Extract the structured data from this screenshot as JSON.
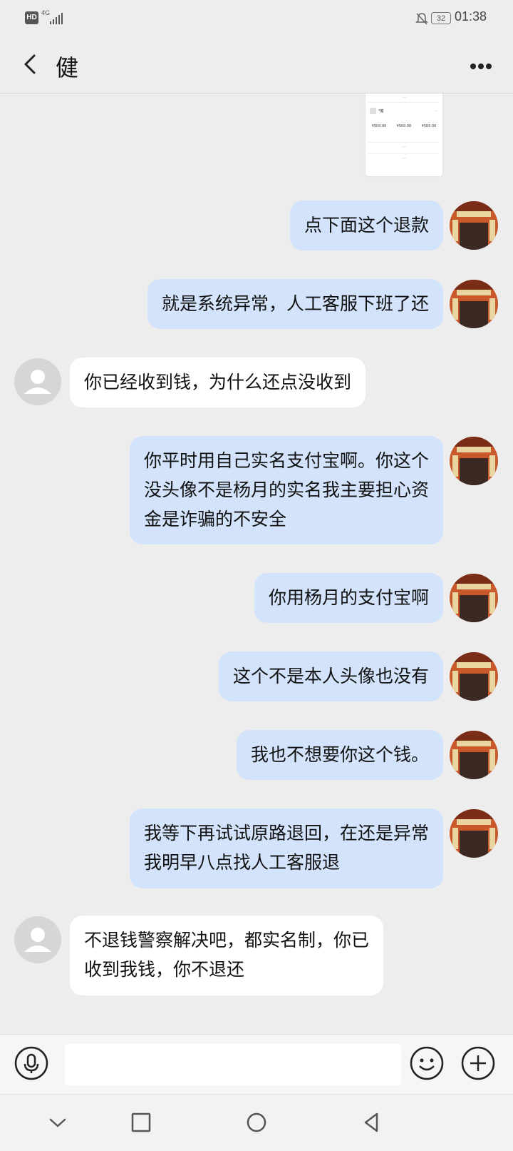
{
  "status_bar": {
    "hd": "HD",
    "network": "4G",
    "battery": "32",
    "time": "01:38"
  },
  "header": {
    "title": "健",
    "back_icon": "chevron-left-icon",
    "more_icon": "more-horizontal-icon"
  },
  "messages": [
    {
      "side": "out",
      "text": "点下面这个退款"
    },
    {
      "side": "out",
      "text": "就是系统异常，人工客服下班了还"
    },
    {
      "side": "in",
      "text": "你已经收到钱，为什么还点没收到"
    },
    {
      "side": "out",
      "text": "你平时用自己实名支付宝啊。你这个\n没头像不是杨月的实名我主要担心资\n金是诈骗的不安全"
    },
    {
      "side": "out",
      "text": "你用杨月的支付宝啊"
    },
    {
      "side": "out",
      "text": "这个不是本人头像也没有"
    },
    {
      "side": "out",
      "text": "我也不想要你这个钱。"
    },
    {
      "side": "out",
      "text": "我等下再试试原路退回，在还是异常\n我明早八点找人工客服退"
    },
    {
      "side": "in",
      "text": "不退钱警察解决吧，都实名制，你已\n收到我钱，你不退还"
    }
  ],
  "screenshot_card": {
    "title": "...",
    "user": "*健",
    "link": "...",
    "cols": [
      {
        "label": "...",
        "value": "¥500.00"
      },
      {
        "label": "...",
        "value": "¥500.00"
      },
      {
        "label": "...",
        "value": "¥500.00"
      }
    ],
    "button1": "...",
    "button2": "..."
  },
  "input_bar": {
    "voice_icon": "microphone-icon",
    "emoji_icon": "emoji-icon",
    "plus_icon": "plus-icon",
    "placeholder": ""
  },
  "nav_bar": {
    "icons": [
      "chevron-down-icon",
      "square-icon",
      "circle-icon",
      "triangle-back-icon"
    ]
  },
  "colors": {
    "outgoing_bubble": "#d2e3fb",
    "incoming_bubble": "#ffffff",
    "background": "#ededed"
  }
}
